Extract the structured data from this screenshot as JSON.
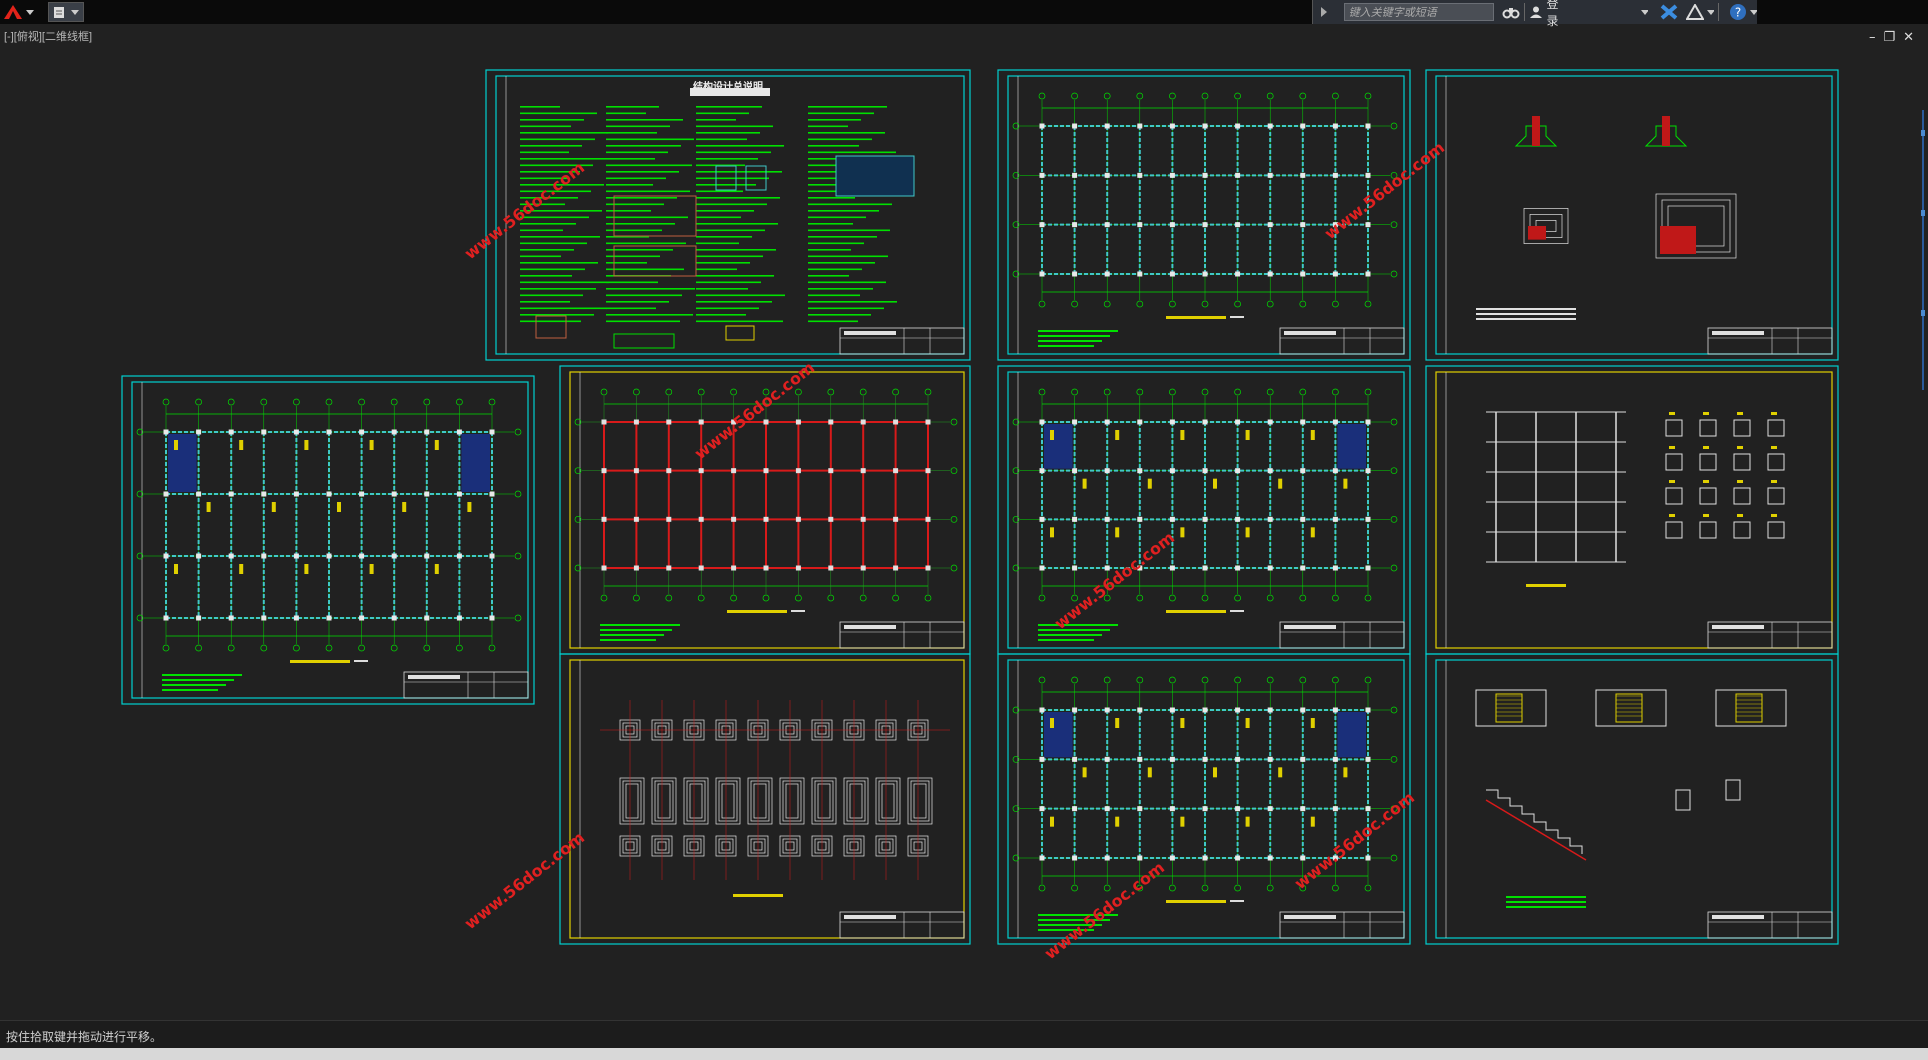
{
  "app": {
    "app_icon": "autocad-logo-icon",
    "quick_access_icon": "quick-access-doc-icon"
  },
  "infocenter": {
    "search_placeholder": "键入关键字或短语",
    "login_label": "登录",
    "icons": [
      "search-binoculars-icon",
      "user-icon",
      "exchange-x-icon",
      "a360-icon",
      "help-icon"
    ]
  },
  "viewport": {
    "label": "[-][俯视][二维线框]"
  },
  "watermark": "www.56doc.com",
  "sheets": [
    {
      "type": "notes",
      "title": "结构设计总说明"
    },
    {
      "type": "plan"
    },
    {
      "type": "details"
    },
    {
      "type": "plan"
    },
    {
      "type": "plan"
    },
    {
      "type": "plan"
    },
    {
      "type": "column-schedule"
    },
    {
      "type": "foundation"
    },
    {
      "type": "plan"
    },
    {
      "type": "stair"
    }
  ],
  "command_line": {
    "prompt": "按住拾取键并拖动进行平移。"
  },
  "colors": {
    "background": "#212121",
    "frame": "#00d0d0",
    "green_line": "#00e000",
    "cyan_line": "#40c8c8",
    "red_line": "#d81a1a",
    "yellow_line": "#e0d000",
    "watermark": "#e02020"
  }
}
